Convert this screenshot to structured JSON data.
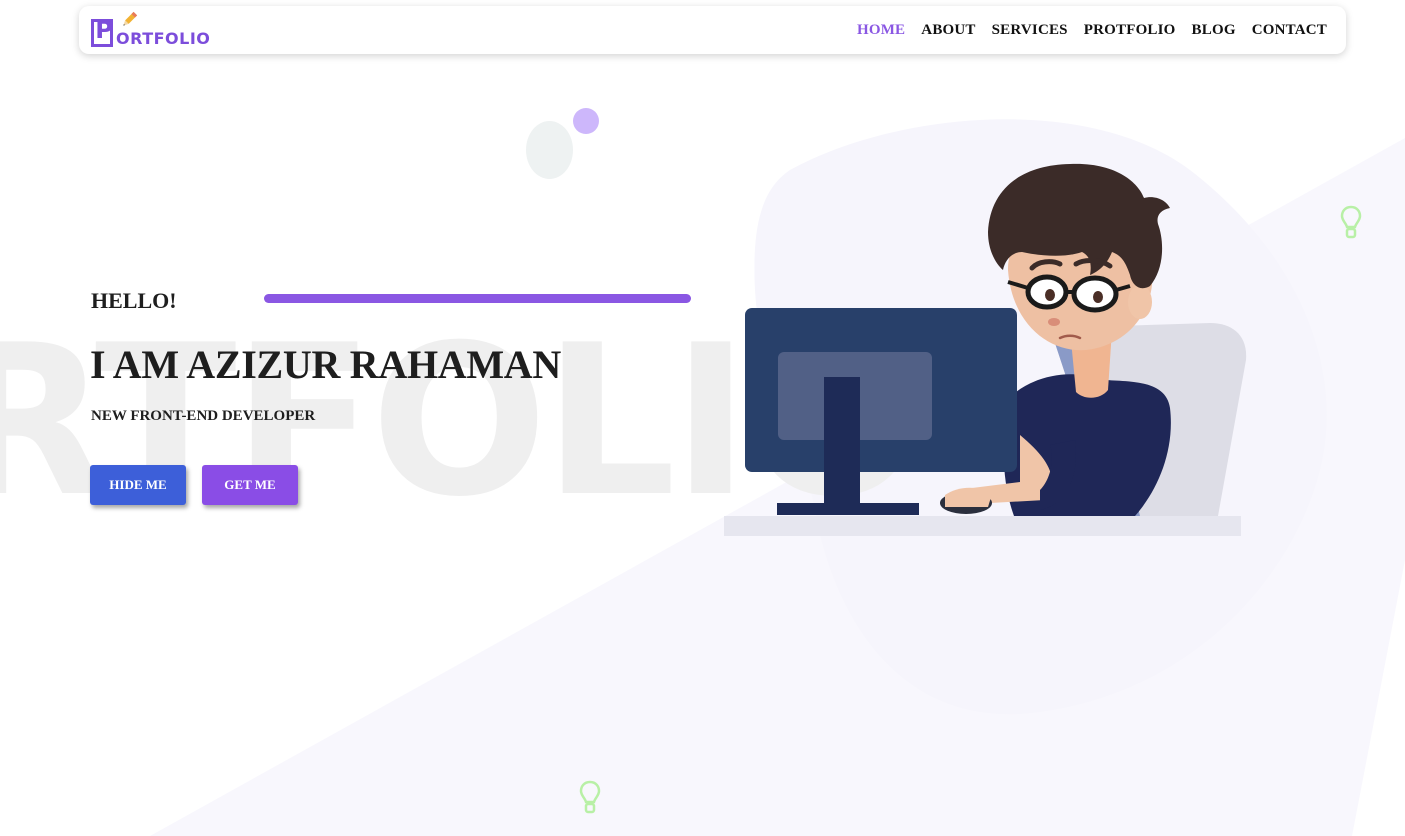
{
  "brand": {
    "logo_letter": "P",
    "logo_text": "ORTFOLIO",
    "accent_color": "#8a57e3"
  },
  "nav": {
    "items": [
      {
        "label": "HOME",
        "active": true
      },
      {
        "label": "ABOUT",
        "active": false
      },
      {
        "label": "SERVICES",
        "active": false
      },
      {
        "label": "PROTFOLIO",
        "active": false
      },
      {
        "label": "BLOG",
        "active": false
      },
      {
        "label": "CONTACT",
        "active": false
      }
    ]
  },
  "hero": {
    "greeting": "HELLO!",
    "name": "I AM AZIZUR RAHAMAN",
    "role": "NEW FRONT-END DEVELOPER",
    "hide_button": "HIDE ME",
    "get_button": "GET ME",
    "watermark": "RTFOLIO"
  },
  "icons": [
    "pencil-icon",
    "lightbulb-icon",
    "developer-illustration"
  ],
  "colors": {
    "hide_button": "#3d5fd9",
    "get_button": "#8a4de6",
    "bulb": "#b8f0a6",
    "background_shape": "#f8f7fd"
  }
}
